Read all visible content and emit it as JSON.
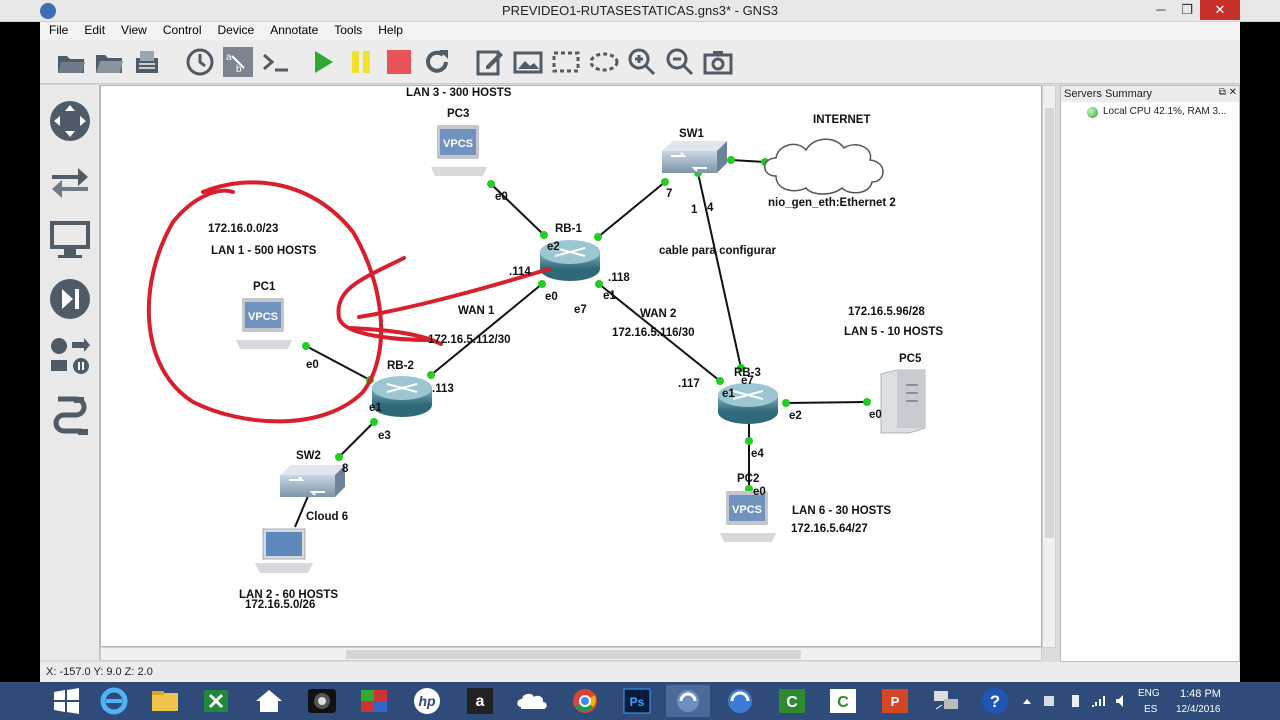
{
  "window": {
    "title": "PREVIDEO1-RUTASESTATICAS.gns3* - GNS3",
    "minimize": "─",
    "maximize": "❐",
    "close": "✕"
  },
  "menu": [
    "File",
    "Edit",
    "View",
    "Control",
    "Device",
    "Annotate",
    "Tools",
    "Help"
  ],
  "toolbar": [
    "open-folder-icon",
    "open-project-icon",
    "save-icon",
    "clock-icon",
    "interface-labels-icon",
    "console-icon",
    "start-icon",
    "suspend-icon",
    "stop-icon",
    "reload-icon",
    "edit-note-icon",
    "insert-image-icon",
    "rectangle-icon",
    "ellipse-icon",
    "zoom-in-icon",
    "zoom-out-icon",
    "screenshot-icon"
  ],
  "left_dock": [
    "routers-icon",
    "switches-icon",
    "end-devices-icon",
    "security-devices-icon",
    "all-devices-icon",
    "add-link-icon"
  ],
  "topology": {
    "lan_labels": {
      "lan3": "LAN 3 - 300 HOSTS",
      "lan1_net": "172.16.0.0/23",
      "lan1": "LAN 1 - 500 HOSTS",
      "wan1": "WAN 1",
      "wan1_net": "172.16.5.112/30",
      "wan2": "WAN 2",
      "wan2_net": "172.16.5.116/30",
      "lan5_net": "172.16.5.96/28",
      "lan5": "LAN 5 - 10 HOSTS",
      "lan6": "LAN 6 - 30 HOSTS",
      "lan6_net": "172.16.5.64/27",
      "lan2": "LAN 2 - 60 HOSTS",
      "lan2_net": "172.16.5.0/26",
      "cable_note": "cable para configurar"
    },
    "nodes": {
      "pc3": "PC3",
      "sw1": "SW1",
      "internet": "INTERNET",
      "nio": "nio_gen_eth:Ethernet 2",
      "rb1": "RB-1",
      "pc1": "PC1",
      "rb2": "RB-2",
      "rb3": "RB-3",
      "pc5": "PC5",
      "pc2": "PC2",
      "sw2": "SW2",
      "cloud6": "Cloud 6",
      "vpcs": "VPCS"
    },
    "ports": {
      "pc3_e0": "e0",
      "rb1_e2": "e2",
      "rb1_114": ".114",
      "rb1_e0": "e0",
      "rb1_e1": "e1",
      "rb1_118": ".118",
      "rb1_e7": "e7",
      "sw1_7": "7",
      "sw1_1": "1",
      "sw1_4": "4",
      "pc1_e0": "e0",
      "rb2_113": ".113",
      "rb2_e1": "e1",
      "rb2_e3": "e3",
      "sw2_8": "8",
      "rb3_117": ".117",
      "rb3_e7": "e7",
      "rb3_e1": "e1",
      "rb3_e2": "e2",
      "rb3_e4": "e4",
      "pc5_e0": "e0",
      "pc2_e0": "e0"
    }
  },
  "servers": {
    "title": "Servers Summary",
    "local": "Local CPU 42.1%, RAM 3..."
  },
  "status": {
    "coords": "X: -157.0 Y: 9.0 Z: 2.0"
  },
  "taskbar": {
    "apps": [
      "windows-start-icon",
      "internet-explorer-icon",
      "file-explorer-icon",
      "excel-icon",
      "home-icon",
      "camera-icon",
      "paint-icon",
      "hp-icon",
      "amazon-icon",
      "onedrive-icon",
      "chrome-icon",
      "photoshop-icon",
      "gns3-icon",
      "app-icon",
      "camtasia-icon",
      "camtasia-recorder-icon",
      "powerpoint-icon",
      "network-icon",
      "help-icon"
    ],
    "lang_top": "ENG",
    "lang_bottom": "ES",
    "time": "1:48 PM",
    "date": "12/4/2016"
  },
  "colors": {
    "link_dot": "#22cc22",
    "annotation": "#d81f2c",
    "router": "#3f7d8c"
  }
}
